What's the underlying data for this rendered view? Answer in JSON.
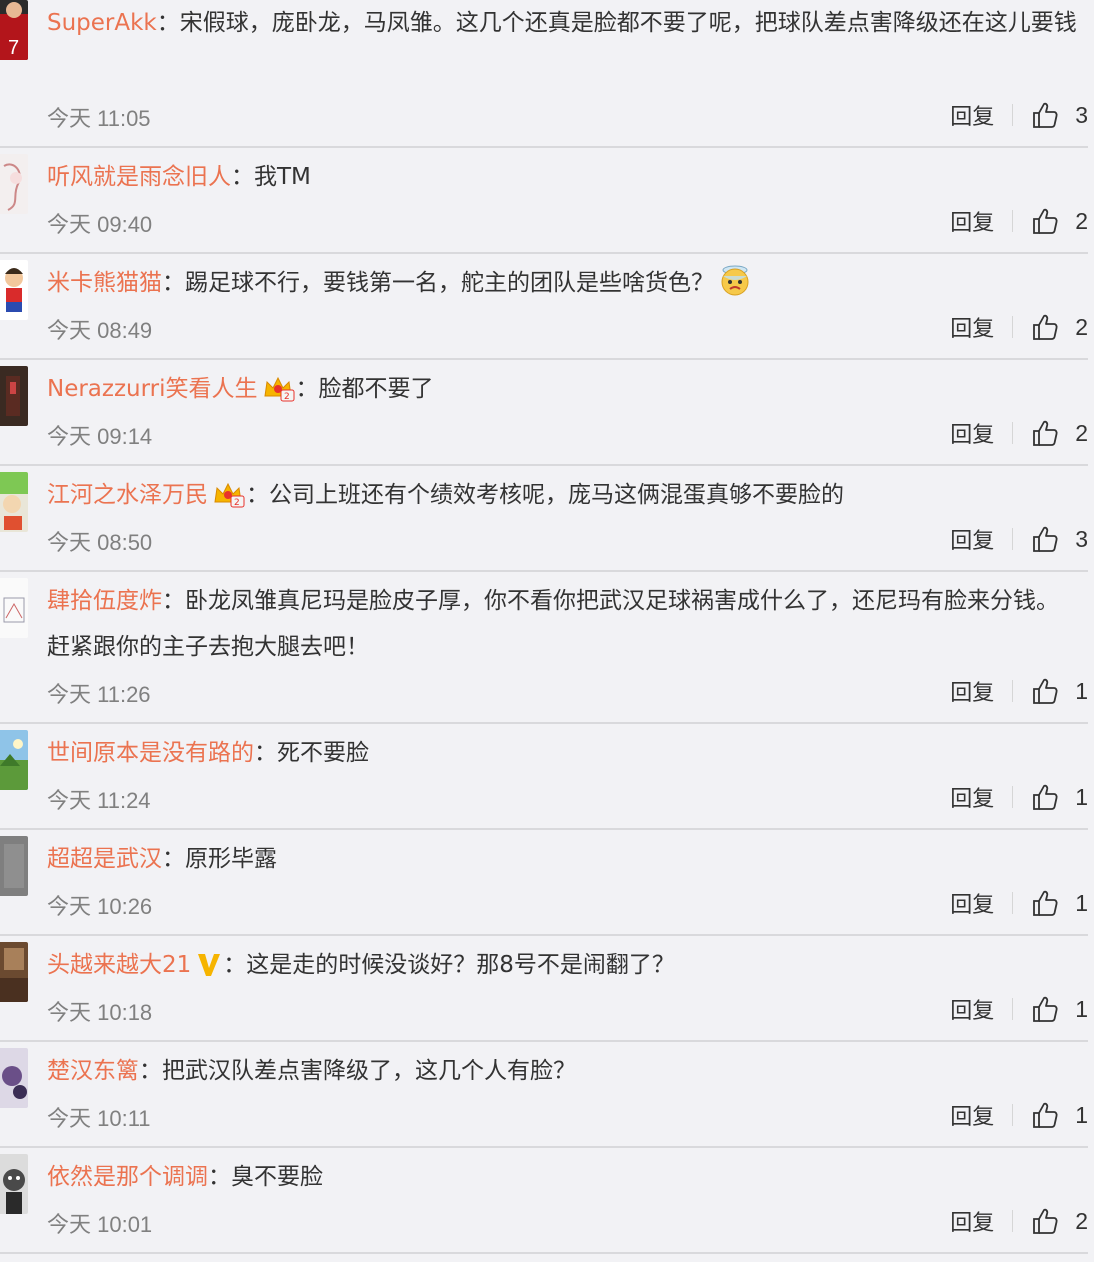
{
  "reply_label": "回复",
  "colon": "：",
  "colors": {
    "username": "#eb7350",
    "text": "#333333",
    "time": "#808080",
    "background": "#f2f2f5",
    "divider": "#d9d9dc"
  },
  "comments": [
    {
      "user": "SuperAkk",
      "text": "宋假球，庞卧龙，马凤雏。这几个还真是脸都不要了呢，把球队差点害降级还在这儿要钱",
      "time": "今天 11:05",
      "likes": "3",
      "avatar": "red-jersey-avatar"
    },
    {
      "user": "听风就是雨念旧人",
      "text": "我TM",
      "time": "今天 09:40",
      "likes": "2",
      "avatar": "sketch-avatar"
    },
    {
      "user": "米卡熊猫猫",
      "text": "踢足球不行，要钱第一名，舵主的团队是些啥货色？",
      "time": "今天 08:49",
      "likes": "2",
      "avatar": "cartoon-avatar",
      "emoji": "jar-emoji"
    },
    {
      "user": "Nerazzurri笑看人生",
      "badge": "crown-badge",
      "text": "脸都不要了",
      "time": "今天 09:14",
      "likes": "2",
      "avatar": "dark-photo-avatar"
    },
    {
      "user": "江河之水泽万民",
      "badge": "crown-badge",
      "text": "公司上班还有个绩效考核呢，庞马这俩混蛋真够不要脸的",
      "time": "今天 08:50",
      "likes": "3",
      "avatar": "crayon-avatar"
    },
    {
      "user": "肆拾伍度炸",
      "text": "卧龙凤雏真尼玛是脸皮子厚，你不看你把武汉足球祸害成什么了，还尼玛有脸来分钱。赶紧跟你的主子去抱大腿去吧！",
      "time": "今天 11:26",
      "likes": "1",
      "avatar": "drawing-avatar"
    },
    {
      "user": "世间原本是没有路的",
      "text": "死不要脸",
      "time": "今天 11:24",
      "likes": "1",
      "avatar": "landscape-avatar"
    },
    {
      "user": "超超是武汉",
      "text": "原形毕露",
      "time": "今天 10:26",
      "likes": "1",
      "avatar": "grey-avatar"
    },
    {
      "user": "头越来越大21",
      "badge": "v-badge",
      "text": "这是走的时候没谈好？那8号不是闹翻了？",
      "time": "今天 10:18",
      "likes": "1",
      "avatar": "brown-photo-avatar"
    },
    {
      "user": "楚汉东篱",
      "text": "把武汉队差点害降级了，这几个人有脸？",
      "time": "今天 10:11",
      "likes": "1",
      "avatar": "purple-photo-avatar"
    },
    {
      "user": "依然是那个调调",
      "text": "臭不要脸",
      "time": "今天 10:01",
      "likes": "2",
      "avatar": "bw-face-avatar"
    }
  ]
}
